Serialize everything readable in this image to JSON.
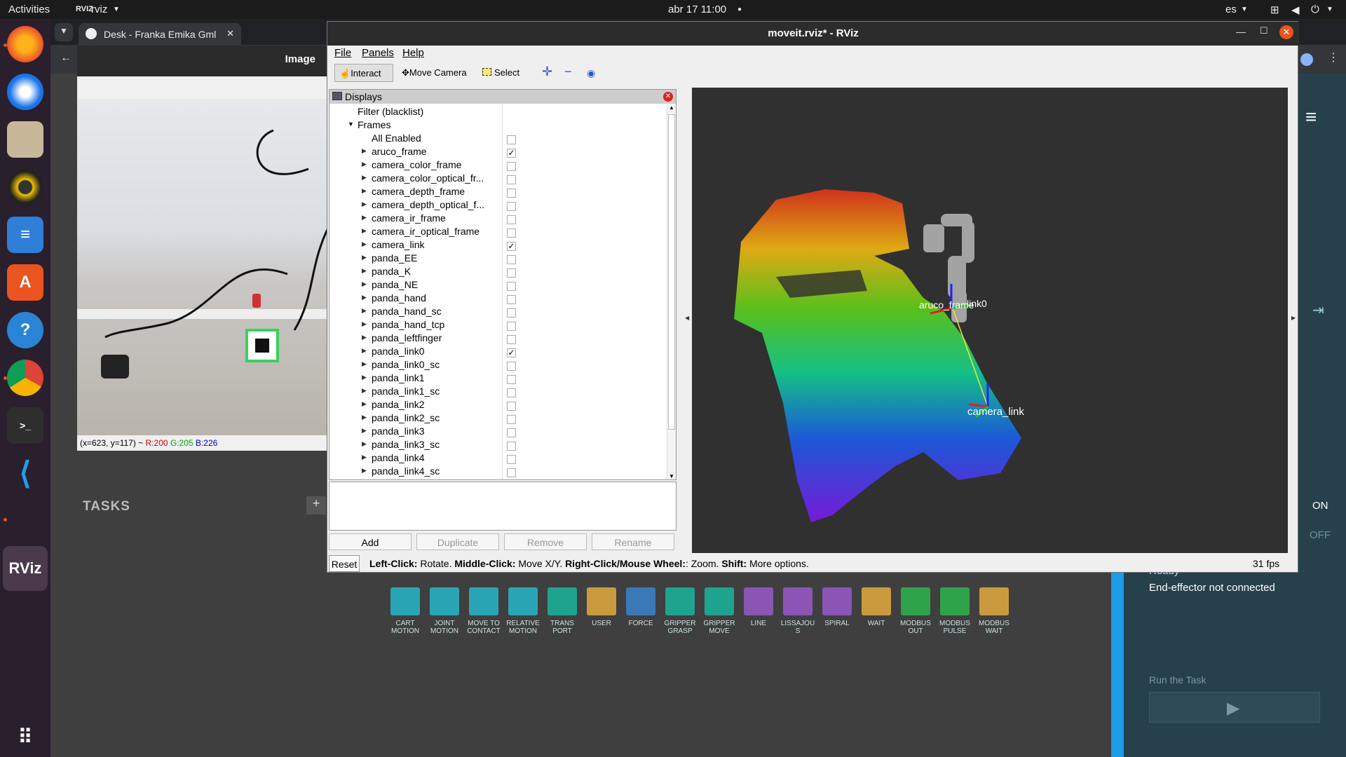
{
  "topbar": {
    "activities": "Activities",
    "app_name": "rviz",
    "datetime": "abr 17  11:00",
    "locale": "es"
  },
  "browser": {
    "tab_title": "Desk - Franka Emika Gml"
  },
  "image_window": {
    "title": "Image",
    "coords_prefix": "(x=623, y=117) ~ ",
    "r": "R:200",
    "g": "G:205",
    "b": "B:226"
  },
  "franka": {
    "tasks_label": "TASKS",
    "tools": [
      {
        "label": "CART MOTION",
        "color": "#2aa5b5"
      },
      {
        "label": "JOINT MOTION",
        "color": "#2aa5b5"
      },
      {
        "label": "MOVE TO CONTACT",
        "color": "#2aa5b5"
      },
      {
        "label": "RELATIVE MOTION",
        "color": "#2aa5b5"
      },
      {
        "label": "TRANS PORT",
        "color": "#1ea38f"
      },
      {
        "label": "USER",
        "color": "#c99a3e"
      },
      {
        "label": "FORCE",
        "color": "#3b79b8"
      },
      {
        "label": "GRIPPER GRASP",
        "color": "#1ea38f"
      },
      {
        "label": "GRIPPER MOVE",
        "color": "#1ea38f"
      },
      {
        "label": "LINE",
        "color": "#8a55b5"
      },
      {
        "label": "LISSAJOU S",
        "color": "#8a55b5"
      },
      {
        "label": "SPIRAL",
        "color": "#8a55b5"
      },
      {
        "label": "WAIT",
        "color": "#c99a3e"
      },
      {
        "label": "MODBUS OUT",
        "color": "#2fa34a"
      },
      {
        "label": "MODBUS PULSE",
        "color": "#2fa34a"
      },
      {
        "label": "MODBUS WAIT",
        "color": "#c99a3e"
      }
    ],
    "right_panel": {
      "on_label": "ON",
      "off_label": "OFF",
      "ready": "Ready",
      "ee_status": "End-effector not connected",
      "run_label": "Run the Task"
    }
  },
  "rviz": {
    "title": "moveit.rviz* - RViz",
    "menus": [
      "File",
      "Panels",
      "Help"
    ],
    "tools": [
      "Interact",
      "Move Camera",
      "Select"
    ],
    "displays_title": "Displays",
    "filter_label": "Filter (blacklist)",
    "frames_label": "Frames",
    "all_enabled": "All Enabled",
    "frames": [
      {
        "name": "aruco_frame",
        "checked": true
      },
      {
        "name": "camera_color_frame",
        "checked": false
      },
      {
        "name": "camera_color_optical_fr...",
        "checked": false
      },
      {
        "name": "camera_depth_frame",
        "checked": false
      },
      {
        "name": "camera_depth_optical_f...",
        "checked": false
      },
      {
        "name": "camera_ir_frame",
        "checked": false
      },
      {
        "name": "camera_ir_optical_frame",
        "checked": false
      },
      {
        "name": "camera_link",
        "checked": true
      },
      {
        "name": "panda_EE",
        "checked": false
      },
      {
        "name": "panda_K",
        "checked": false
      },
      {
        "name": "panda_NE",
        "checked": false
      },
      {
        "name": "panda_hand",
        "checked": false
      },
      {
        "name": "panda_hand_sc",
        "checked": false
      },
      {
        "name": "panda_hand_tcp",
        "checked": false
      },
      {
        "name": "panda_leftfinger",
        "checked": false
      },
      {
        "name": "panda_link0",
        "checked": true
      },
      {
        "name": "panda_link0_sc",
        "checked": false
      },
      {
        "name": "panda_link1",
        "checked": false
      },
      {
        "name": "panda_link1_sc",
        "checked": false
      },
      {
        "name": "panda_link2",
        "checked": false
      },
      {
        "name": "panda_link2_sc",
        "checked": false
      },
      {
        "name": "panda_link3",
        "checked": false
      },
      {
        "name": "panda_link3_sc",
        "checked": false
      },
      {
        "name": "panda_link4",
        "checked": false
      },
      {
        "name": "panda_link4_sc",
        "checked": false
      }
    ],
    "buttons": {
      "add": "Add",
      "duplicate": "Duplicate",
      "remove": "Remove",
      "rename": "Rename"
    },
    "view_labels": {
      "aruco": "aruco_frame",
      "link0": "link0",
      "camera_link": "camera_link"
    },
    "status": {
      "reset": "Reset",
      "left_click": "Left-Click:",
      "left_click_desc": " Rotate. ",
      "middle_click": "Middle-Click:",
      "middle_click_desc": " Move X/Y. ",
      "right_click": "Right-Click/Mouse Wheel:",
      "right_click_desc": ": Zoom. ",
      "shift": "Shift:",
      "shift_desc": " More options.",
      "fps": "31 fps"
    }
  }
}
